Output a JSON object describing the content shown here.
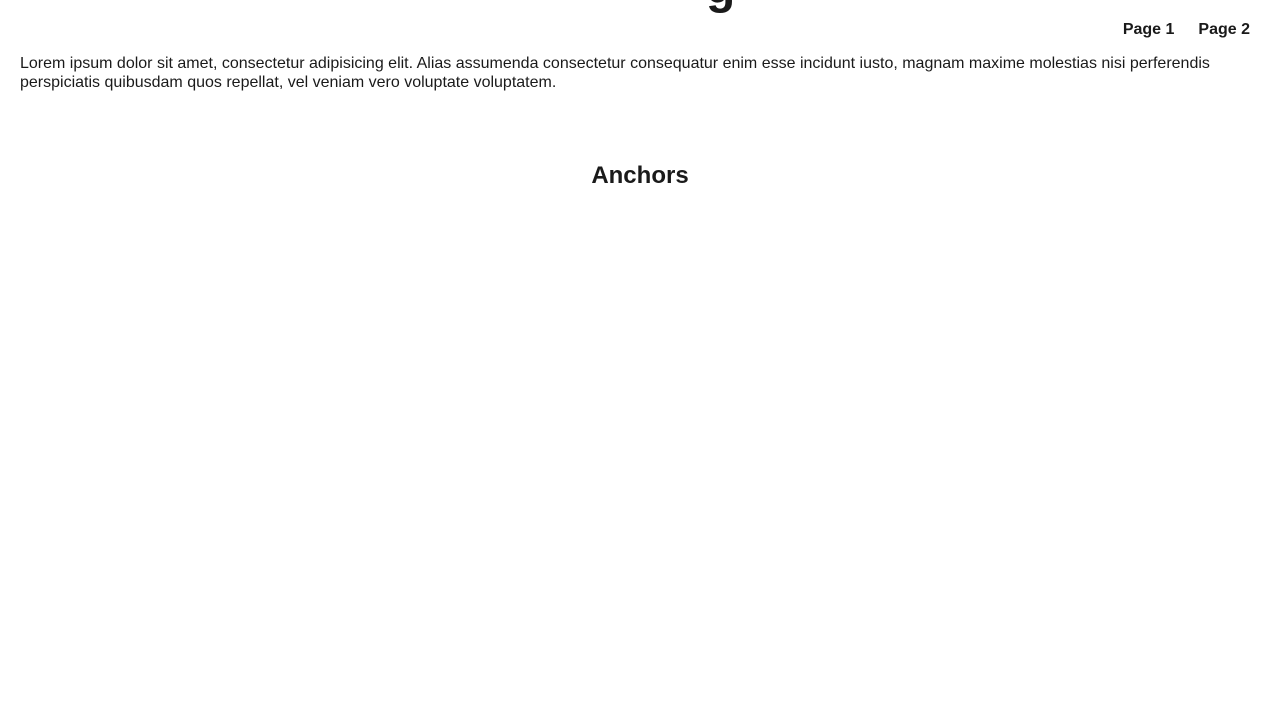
{
  "header": {
    "hero_fragment": "g"
  },
  "nav": {
    "items": [
      {
        "label": "Page 1"
      },
      {
        "label": "Page 2"
      }
    ]
  },
  "main": {
    "intro_text": "Lorem ipsum dolor sit amet, consectetur adipisicing elit. Alias assumenda consectetur consequatur enim esse incidunt iusto, magnam maxime molestias nisi perferendis perspiciatis quibusdam quos repellat, vel veniam vero voluptate voluptatem.",
    "section_heading": "Anchors"
  }
}
